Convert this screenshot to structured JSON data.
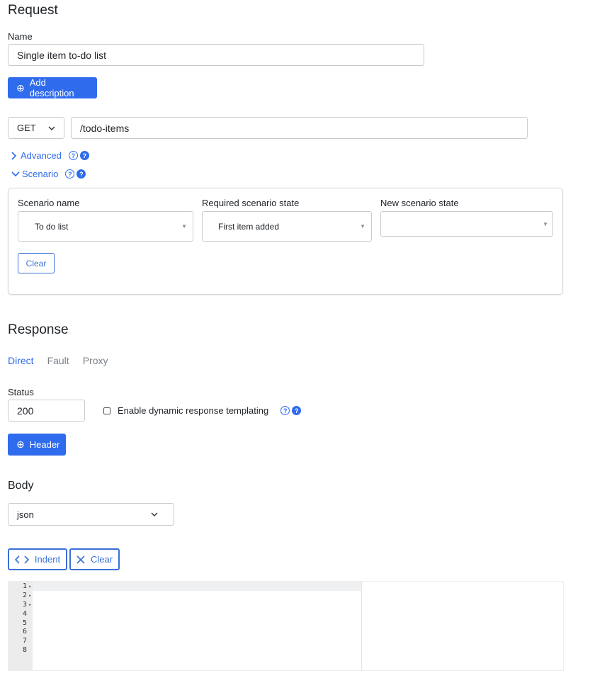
{
  "request": {
    "title": "Request",
    "name_label": "Name",
    "name_value": "Single item to-do list",
    "add_description_label": "Add description",
    "method": "GET",
    "url": "/todo-items",
    "advanced_label": "Advanced",
    "scenario_label": "Scenario",
    "scenario": {
      "name_label": "Scenario name",
      "name_value": "To do list",
      "required_state_label": "Required scenario state",
      "required_state_value": "First item added",
      "new_state_label": "New scenario state",
      "new_state_value": "",
      "clear_label": "Clear"
    }
  },
  "response": {
    "title": "Response",
    "tabs": [
      {
        "label": "Direct",
        "active": true
      },
      {
        "label": "Fault",
        "active": false
      },
      {
        "label": "Proxy",
        "active": false
      }
    ],
    "status_label": "Status",
    "status_value": "200",
    "templating_label": "Enable dynamic response templating",
    "templating_checked": false,
    "header_button_label": "Header",
    "body_title": "Body",
    "body_format": "json",
    "indent_label": "Indent",
    "clear_label": "Clear",
    "editor": {
      "line_numbers": [
        "1",
        "2",
        "3",
        "4",
        "5",
        "6",
        "7",
        "8"
      ],
      "fold_markers": [
        "▾",
        "▾",
        "▾",
        "",
        "",
        "",
        "",
        ""
      ]
    }
  },
  "icons": {
    "help_outline": "?",
    "help_filled": "?",
    "plus_circle": "⊕",
    "chevron_right": "chevron-right-icon",
    "chevron_down": "chevron-down-icon"
  },
  "colors": {
    "accent": "#2f6bed",
    "string": "#1a7f1a",
    "key": "#2d5db0"
  }
}
